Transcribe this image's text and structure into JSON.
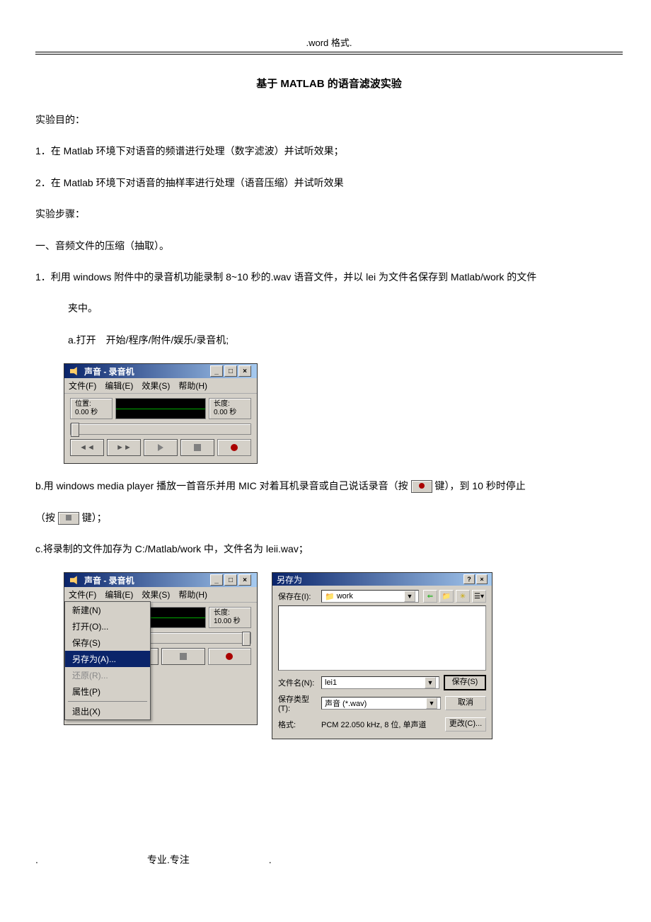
{
  "header": ".word 格式.",
  "title": "基于 MATLAB 的语音滤波实验",
  "p_obj": "实验目的：",
  "p1": "1．在 Matlab 环境下对语音的频谱进行处理（数字滤波）并试听效果；",
  "p2": "2．在 Matlab 环境下对语音的抽样率进行处理（语音压缩）并试听效果",
  "p_steps": "实验步骤：",
  "p_sec1": "一、音频文件的压缩（抽取）。",
  "p_s1_1": "1．利用 windows 附件中的录音机功能录制 8~10 秒的.wav 语音文件，并以 lei 为文件名保存到 Matlab/work 的文件",
  "p_s1_1b": "夹中。",
  "p_s1_a": "a.打开　开始/程序/附件/娱乐/录音机;",
  "p_s1_b_pre": "b.用 windows media player 播放一首音乐并用 MIC 对着耳机录音或自己说话录音（按",
  "p_s1_b_mid": "键），到 10 秒时停止",
  "p_s1_b_end": "（按",
  "p_s1_b_end2": "键）；",
  "p_s1_c": "c.将录制的文件加存为 C:/Matlab/work 中，文件名为 leii.wav；",
  "footer": ".　　　　　　　　　　　专业.专注　　　　　　　　.",
  "recorder": {
    "title": "声音 - 录音机",
    "menu_file": "文件(F)",
    "menu_edit": "编辑(E)",
    "menu_effects": "效果(S)",
    "menu_help": "帮助(H)",
    "pos_label": "位置:",
    "pos_value": "0.00 秒",
    "len_label": "长度:",
    "len_value": "0.00 秒",
    "len_value2": "10.00 秒"
  },
  "filemenu": {
    "new": "新建(N)",
    "open": "打开(O)...",
    "save": "保存(S)",
    "saveas": "另存为(A)...",
    "revert": "还原(R)...",
    "props": "属性(P)",
    "exit": "退出(X)"
  },
  "saveas": {
    "title": "另存为",
    "savein": "保存在(I):",
    "folder": "work",
    "filename_label": "文件名(N):",
    "filename_value": "lei1",
    "filetype_label": "保存类型(T):",
    "filetype_value": "声音 (*.wav)",
    "format_label": "格式:",
    "format_value": "PCM 22.050 kHz, 8 位, 单声道",
    "btn_save": "保存(S)",
    "btn_cancel": "取消",
    "btn_change": "更改(C)..."
  }
}
